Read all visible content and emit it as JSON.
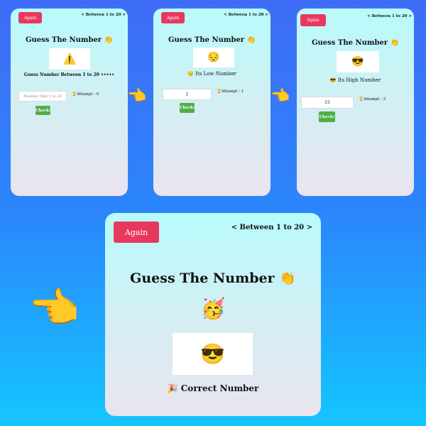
{
  "common": {
    "again_label": "Again",
    "range_label": "< Between 1 to 20 >",
    "title": "Guess The Number 👏",
    "check_label": "Check!"
  },
  "icons": {
    "pointer": "👉",
    "pointer_name": "pointing-hand-icon"
  },
  "screens": {
    "s1": {
      "emoji": "⚠️",
      "emoji_name": "warning-icon",
      "message": "Guess Number Between 1 to 20 •••••",
      "input_value": "",
      "input_placeholder": "Number Only 1 to 20",
      "attempt": "🏆Attampt : 0"
    },
    "s2": {
      "emoji": "😔",
      "emoji_name": "pensive-face-icon",
      "message": "😔 Its Low Number",
      "input_value": "1",
      "input_placeholder": "",
      "attempt": "🏆Attampt : 1"
    },
    "s3": {
      "emoji": "😎",
      "emoji_name": "sunglasses-face-icon",
      "message": "😎 Its High Number",
      "input_value": "15",
      "input_placeholder": "",
      "attempt": "🏆Attampt : 3"
    },
    "s4": {
      "party_emoji": "🥳",
      "emoji": "😎",
      "emoji_name": "sunglasses-face-icon",
      "message": "🎉 Correct Number"
    }
  }
}
